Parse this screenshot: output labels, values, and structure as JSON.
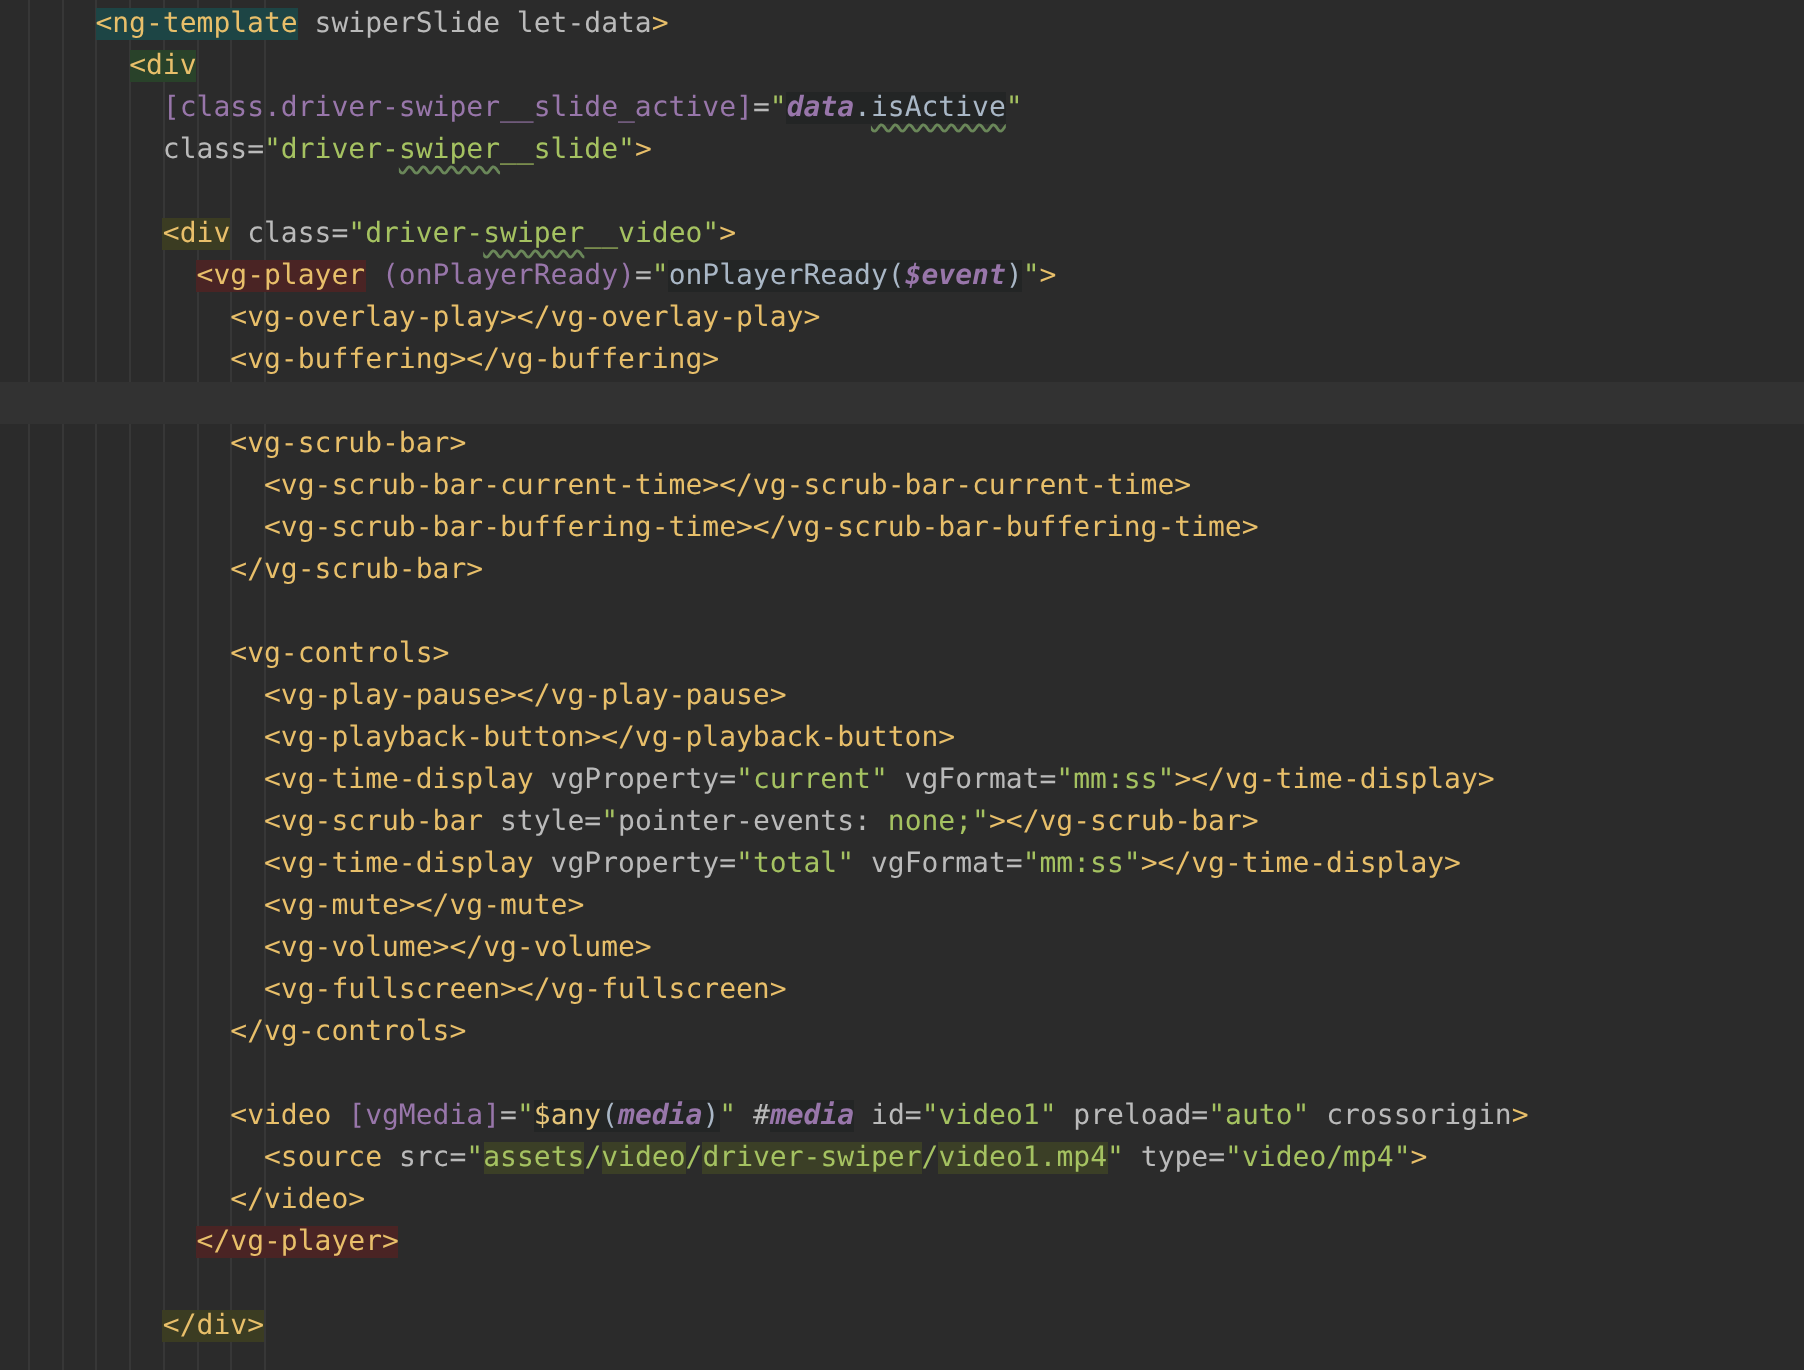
{
  "lines": [
    {
      "kind": "code",
      "tokens": [
        {
          "kind": "tag",
          "text": "<ng-template",
          "color": "#1d4545"
        },
        {
          "kind": "attr",
          "text": " swiperSlide let-data"
        },
        {
          "kind": "tag",
          "text": ">"
        }
      ],
      "children": [
        {
          "kind": "code",
          "tokens": [
            {
              "kind": "tag",
              "text": "<div",
              "color": "#29422a"
            }
          ],
          "children": [
            {
              "kind": "code",
              "tokens": [
                {
                  "kind": "bind",
                  "text": "[class.driver-swiper__slide_active]"
                },
                {
                  "kind": "attr",
                  "text": "="
                },
                {
                  "kind": "str",
                  "text": "\""
                },
                {
                  "kind": "var",
                  "text": "data"
                },
                {
                  "kind": "code",
                  "text": "."
                },
                {
                  "kind": "code",
                  "text": "isActive",
                  "typo": true
                },
                {
                  "kind": "str",
                  "text": "\""
                }
              ]
            },
            {
              "kind": "code",
              "tokens": [
                {
                  "kind": "attr",
                  "text": "class="
                },
                {
                  "kind": "str",
                  "text": "\"driver-"
                },
                {
                  "kind": "str",
                  "text": "swiper",
                  "typo": true
                },
                {
                  "kind": "str",
                  "text": "__slide\""
                },
                {
                  "kind": "tag",
                  "text": ">"
                }
              ]
            },
            {
              "kind": "blank"
            },
            {
              "kind": "code",
              "tokens": [
                {
                  "kind": "tag",
                  "text": "<div",
                  "color": "#3b3c22"
                },
                {
                  "kind": "attr",
                  "text": " class="
                },
                {
                  "kind": "str",
                  "text": "\"driver-"
                },
                {
                  "kind": "str",
                  "text": "swiper",
                  "typo": true
                },
                {
                  "kind": "str",
                  "text": "__video\""
                },
                {
                  "kind": "tag",
                  "text": ">"
                }
              ],
              "children": [
                {
                  "kind": "code",
                  "tokens": [
                    {
                      "kind": "tag",
                      "text": "<vg-player",
                      "color": "#4a2424"
                    },
                    {
                      "kind": "bind",
                      "text": " (onPlayerReady)"
                    },
                    {
                      "kind": "attr",
                      "text": "="
                    },
                    {
                      "kind": "str",
                      "text": "\""
                    },
                    {
                      "kind": "code",
                      "text": "onPlayerReady("
                    },
                    {
                      "kind": "var",
                      "text": "$event"
                    },
                    {
                      "kind": "code",
                      "text": ")"
                    },
                    {
                      "kind": "str",
                      "text": "\""
                    },
                    {
                      "kind": "tag",
                      "text": ">"
                    }
                  ],
                  "children": [
                    {
                      "kind": "code",
                      "tokens": [
                        {
                          "kind": "tag",
                          "text": "<vg-overlay-play></vg-overlay-play>"
                        }
                      ]
                    },
                    {
                      "kind": "code",
                      "tokens": [
                        {
                          "kind": "tag",
                          "text": "<vg-buffering></vg-buffering>"
                        }
                      ]
                    },
                    {
                      "kind": "current"
                    },
                    {
                      "kind": "code",
                      "tokens": [
                        {
                          "kind": "tag",
                          "text": "<vg-scrub-bar>"
                        }
                      ],
                      "children": [
                        {
                          "kind": "code",
                          "tokens": [
                            {
                              "kind": "tag",
                              "text": "<vg-scrub-bar-current-time></vg-scrub-bar-current-time>"
                            }
                          ]
                        },
                        {
                          "kind": "code",
                          "tokens": [
                            {
                              "kind": "tag",
                              "text": "<vg-scrub-bar-buffering-time></vg-scrub-bar-buffering-time>"
                            }
                          ]
                        }
                      ]
                    },
                    {
                      "kind": "code",
                      "tokens": [
                        {
                          "kind": "tag",
                          "text": "</vg-scrub-bar>"
                        }
                      ]
                    },
                    {
                      "kind": "blank"
                    },
                    {
                      "kind": "code",
                      "tokens": [
                        {
                          "kind": "tag",
                          "text": "<vg-controls>"
                        }
                      ],
                      "children": [
                        {
                          "kind": "code",
                          "tokens": [
                            {
                              "kind": "tag",
                              "text": "<vg-play-pause></vg-play-pause>"
                            }
                          ]
                        },
                        {
                          "kind": "code",
                          "tokens": [
                            {
                              "kind": "tag",
                              "text": "<vg-playback-button></vg-playback-button>"
                            }
                          ]
                        },
                        {
                          "kind": "code",
                          "tokens": [
                            {
                              "kind": "tag",
                              "text": "<vg-time-display"
                            },
                            {
                              "kind": "attr",
                              "text": " vgProperty="
                            },
                            {
                              "kind": "str",
                              "text": "\"current\""
                            },
                            {
                              "kind": "attr",
                              "text": " vgFormat="
                            },
                            {
                              "kind": "str",
                              "text": "\"mm:ss\""
                            },
                            {
                              "kind": "tag",
                              "text": "></vg-time-display>"
                            }
                          ]
                        },
                        {
                          "kind": "code",
                          "tokens": [
                            {
                              "kind": "tag",
                              "text": "<vg-scrub-bar"
                            },
                            {
                              "kind": "attr",
                              "text": " style="
                            },
                            {
                              "kind": "str",
                              "text": "\""
                            },
                            {
                              "kind": "attr",
                              "text": "pointer-events: "
                            },
                            {
                              "kind": "str",
                              "text": "none;\""
                            },
                            {
                              "kind": "tag",
                              "text": "></vg-scrub-bar>"
                            }
                          ]
                        },
                        {
                          "kind": "code",
                          "tokens": [
                            {
                              "kind": "tag",
                              "text": "<vg-time-display"
                            },
                            {
                              "kind": "attr",
                              "text": " vgProperty="
                            },
                            {
                              "kind": "str",
                              "text": "\"total\""
                            },
                            {
                              "kind": "attr",
                              "text": " vgFormat="
                            },
                            {
                              "kind": "str",
                              "text": "\"mm:ss\""
                            },
                            {
                              "kind": "tag",
                              "text": "></vg-time-display>"
                            }
                          ]
                        },
                        {
                          "kind": "code",
                          "tokens": [
                            {
                              "kind": "tag",
                              "text": "<vg-mute></vg-mute>"
                            }
                          ]
                        },
                        {
                          "kind": "code",
                          "tokens": [
                            {
                              "kind": "tag",
                              "text": "<vg-volume></vg-volume>"
                            }
                          ]
                        },
                        {
                          "kind": "code",
                          "tokens": [
                            {
                              "kind": "tag",
                              "text": "<vg-fullscreen></vg-fullscreen>"
                            }
                          ]
                        }
                      ]
                    },
                    {
                      "kind": "code",
                      "tokens": [
                        {
                          "kind": "tag",
                          "text": "</vg-controls>"
                        }
                      ]
                    },
                    {
                      "kind": "blank"
                    },
                    {
                      "kind": "code",
                      "tokens": [
                        {
                          "kind": "tag",
                          "text": "<video"
                        },
                        {
                          "kind": "bind",
                          "text": " [vgMedia]"
                        },
                        {
                          "kind": "attr",
                          "text": "="
                        },
                        {
                          "kind": "str",
                          "text": "\""
                        },
                        {
                          "kind": "func",
                          "text": "$any"
                        },
                        {
                          "kind": "code",
                          "text": "("
                        },
                        {
                          "kind": "var",
                          "text": "media"
                        },
                        {
                          "kind": "code",
                          "text": ")"
                        },
                        {
                          "kind": "str",
                          "text": "\""
                        },
                        {
                          "kind": "attr",
                          "text": " #"
                        },
                        {
                          "kind": "var",
                          "text": "media"
                        },
                        {
                          "kind": "attr",
                          "text": " id="
                        },
                        {
                          "kind": "str",
                          "text": "\"video1\""
                        },
                        {
                          "kind": "attr",
                          "text": " preload="
                        },
                        {
                          "kind": "str",
                          "text": "\"auto\""
                        },
                        {
                          "kind": "attr",
                          "text": " crossorigin"
                        },
                        {
                          "kind": "tag",
                          "text": ">"
                        }
                      ],
                      "children": [
                        {
                          "kind": "code",
                          "tokens": [
                            {
                              "kind": "tag",
                              "text": "<source"
                            },
                            {
                              "kind": "attr",
                              "text": " src="
                            },
                            {
                              "kind": "str",
                              "text": "\""
                            },
                            {
                              "kind": "str",
                              "text": "assets",
                              "color": "#3b3f26"
                            },
                            {
                              "kind": "str",
                              "text": "/"
                            },
                            {
                              "kind": "str",
                              "text": "video",
                              "color": "#3b3f26"
                            },
                            {
                              "kind": "str",
                              "text": "/"
                            },
                            {
                              "kind": "str",
                              "text": "driver-swiper",
                              "color": "#3b3f26"
                            },
                            {
                              "kind": "str",
                              "text": "/"
                            },
                            {
                              "kind": "str",
                              "text": "video1.mp4",
                              "color": "#3b3f26"
                            },
                            {
                              "kind": "str",
                              "text": "\""
                            },
                            {
                              "kind": "attr",
                              "text": " type="
                            },
                            {
                              "kind": "str",
                              "text": "\"video/mp4\""
                            },
                            {
                              "kind": "tag",
                              "text": ">"
                            }
                          ]
                        }
                      ]
                    },
                    {
                      "kind": "code",
                      "tokens": [
                        {
                          "kind": "tag",
                          "text": "</video>"
                        }
                      ]
                    }
                  ]
                },
                {
                  "kind": "code",
                  "tokens": [
                    {
                      "kind": "tag",
                      "text": "</vg-player>",
                      "color": "#4a2424"
                    }
                  ]
                }
              ]
            },
            {
              "kind": "blank"
            },
            {
              "kind": "code",
              "tokens": [
                {
                  "kind": "tag",
                  "text": "</div>",
                  "color": "#3b3c22"
                }
              ]
            }
          ]
        }
      ]
    }
  ]
}
